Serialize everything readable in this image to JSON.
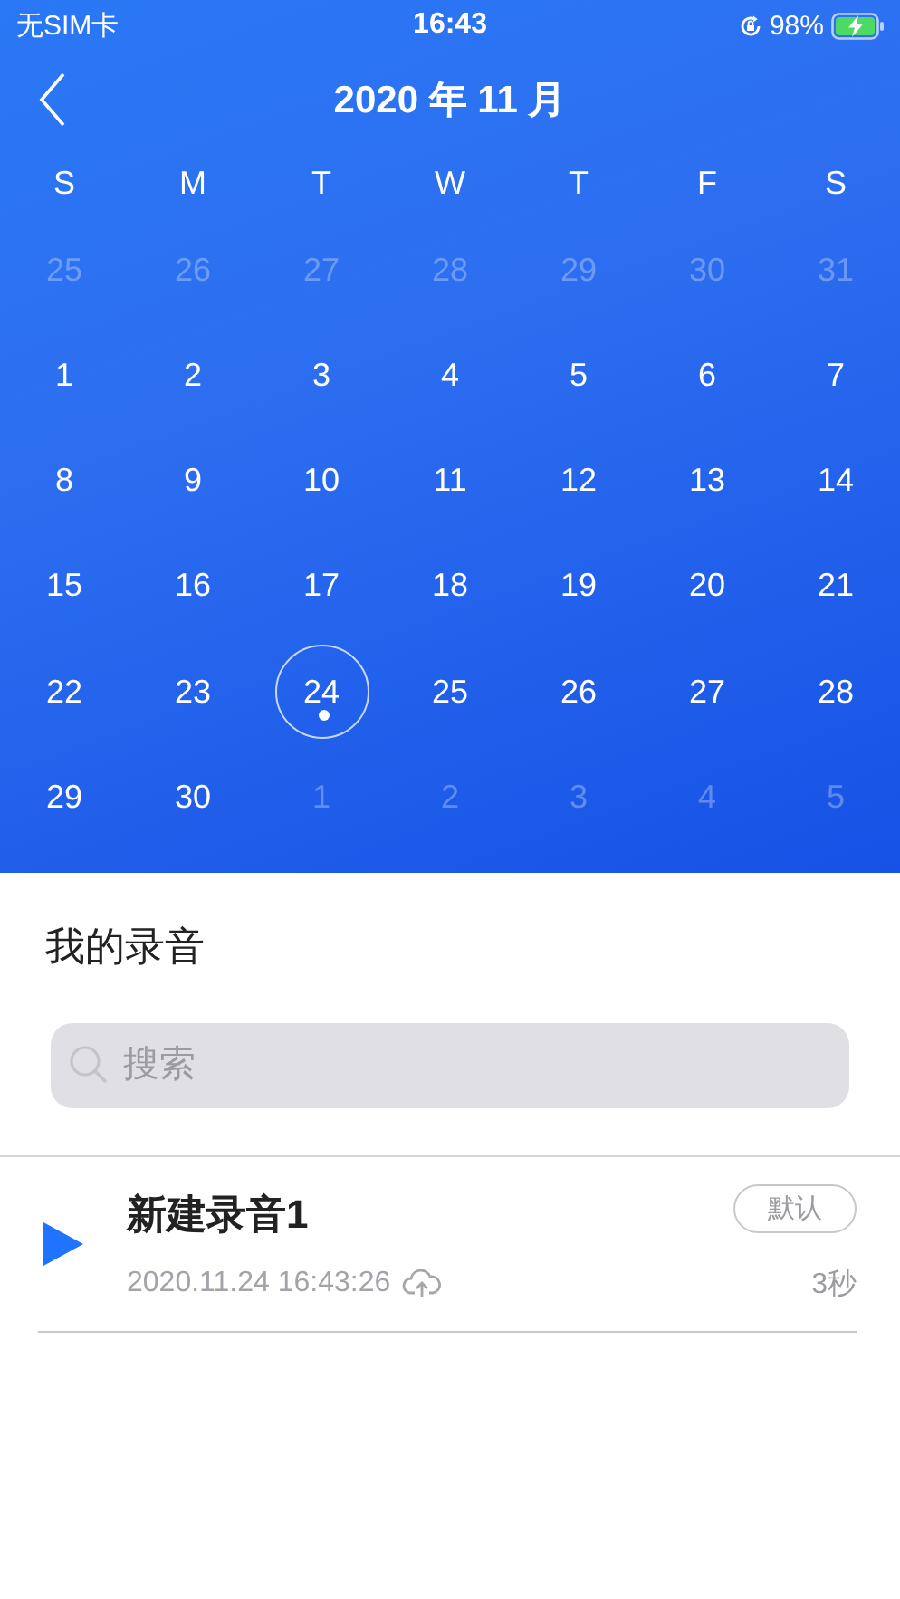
{
  "status_bar": {
    "carrier": "无SIM卡",
    "time": "16:43",
    "battery": "98%"
  },
  "calendar": {
    "title": "2020 年 11 月",
    "weekdays": [
      "S",
      "M",
      "T",
      "W",
      "T",
      "F",
      "S"
    ],
    "days": [
      {
        "label": "25",
        "in_month": false,
        "selected": false
      },
      {
        "label": "26",
        "in_month": false,
        "selected": false
      },
      {
        "label": "27",
        "in_month": false,
        "selected": false
      },
      {
        "label": "28",
        "in_month": false,
        "selected": false
      },
      {
        "label": "29",
        "in_month": false,
        "selected": false
      },
      {
        "label": "30",
        "in_month": false,
        "selected": false
      },
      {
        "label": "31",
        "in_month": false,
        "selected": false
      },
      {
        "label": "1",
        "in_month": true,
        "selected": false
      },
      {
        "label": "2",
        "in_month": true,
        "selected": false
      },
      {
        "label": "3",
        "in_month": true,
        "selected": false
      },
      {
        "label": "4",
        "in_month": true,
        "selected": false
      },
      {
        "label": "5",
        "in_month": true,
        "selected": false
      },
      {
        "label": "6",
        "in_month": true,
        "selected": false
      },
      {
        "label": "7",
        "in_month": true,
        "selected": false
      },
      {
        "label": "8",
        "in_month": true,
        "selected": false
      },
      {
        "label": "9",
        "in_month": true,
        "selected": false
      },
      {
        "label": "10",
        "in_month": true,
        "selected": false
      },
      {
        "label": "11",
        "in_month": true,
        "selected": false
      },
      {
        "label": "12",
        "in_month": true,
        "selected": false
      },
      {
        "label": "13",
        "in_month": true,
        "selected": false
      },
      {
        "label": "14",
        "in_month": true,
        "selected": false
      },
      {
        "label": "15",
        "in_month": true,
        "selected": false
      },
      {
        "label": "16",
        "in_month": true,
        "selected": false
      },
      {
        "label": "17",
        "in_month": true,
        "selected": false
      },
      {
        "label": "18",
        "in_month": true,
        "selected": false
      },
      {
        "label": "19",
        "in_month": true,
        "selected": false
      },
      {
        "label": "20",
        "in_month": true,
        "selected": false
      },
      {
        "label": "21",
        "in_month": true,
        "selected": false
      },
      {
        "label": "22",
        "in_month": true,
        "selected": false
      },
      {
        "label": "23",
        "in_month": true,
        "selected": false
      },
      {
        "label": "24",
        "in_month": true,
        "selected": true,
        "has_recording": true
      },
      {
        "label": "25",
        "in_month": true,
        "selected": false
      },
      {
        "label": "26",
        "in_month": true,
        "selected": false
      },
      {
        "label": "27",
        "in_month": true,
        "selected": false
      },
      {
        "label": "28",
        "in_month": true,
        "selected": false
      },
      {
        "label": "29",
        "in_month": true,
        "selected": false
      },
      {
        "label": "30",
        "in_month": true,
        "selected": false
      },
      {
        "label": "1",
        "in_month": false,
        "selected": false
      },
      {
        "label": "2",
        "in_month": false,
        "selected": false
      },
      {
        "label": "3",
        "in_month": false,
        "selected": false
      },
      {
        "label": "4",
        "in_month": false,
        "selected": false
      },
      {
        "label": "5",
        "in_month": false,
        "selected": false
      }
    ]
  },
  "section_title": "我的录音",
  "search": {
    "placeholder": "搜索"
  },
  "recordings": [
    {
      "name": "新建录音1",
      "timestamp": "2020.11.24 16:43:26",
      "tag": "默认",
      "duration": "3秒"
    }
  ]
}
